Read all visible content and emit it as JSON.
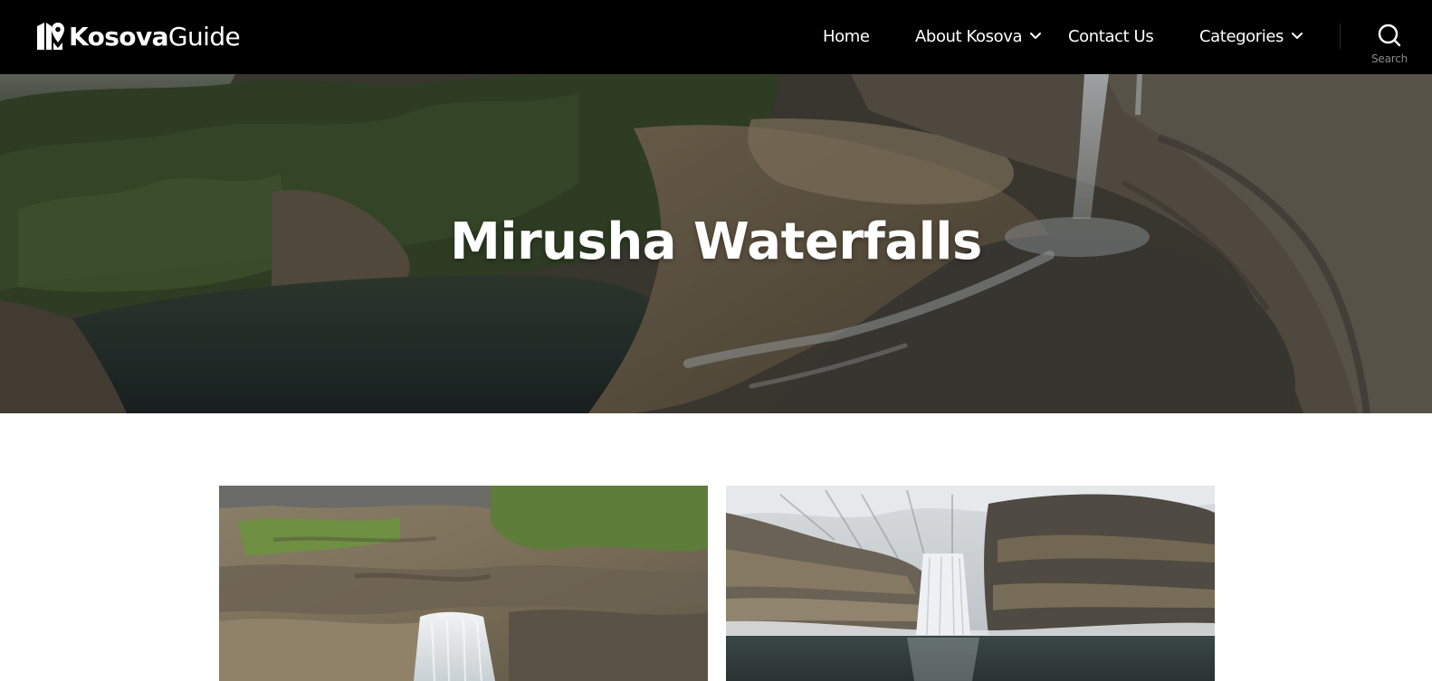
{
  "site": {
    "logo_bold": "Kosova",
    "logo_light": "Guide"
  },
  "nav": {
    "items": [
      {
        "label": "Home",
        "has_dropdown": false
      },
      {
        "label": "About Kosova",
        "has_dropdown": true
      },
      {
        "label": "Contact Us",
        "has_dropdown": false
      },
      {
        "label": "Categories",
        "has_dropdown": true
      }
    ],
    "search_label": "Search",
    "icons": [
      "map-pin-logo-icon",
      "chevron-down-icon",
      "search-icon"
    ]
  },
  "hero": {
    "title": "Mirusha Waterfalls"
  },
  "gallery": {
    "items": [
      {
        "alt": "Mirusha waterfall over layered limestone cliffs"
      },
      {
        "alt": "Mirusha waterfall in winter with frosted trees and pool"
      }
    ]
  },
  "colors": {
    "header_bg": "#000000",
    "text_on_dark": "#ffffff",
    "search_label": "#8a8a8a",
    "page_bg": "#ffffff"
  }
}
